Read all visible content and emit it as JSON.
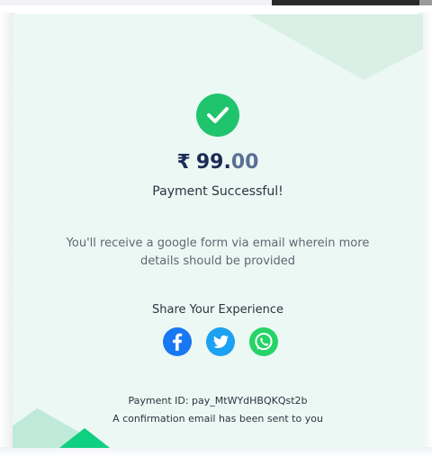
{
  "payment": {
    "currency_symbol": "₹",
    "amount_whole": "99.",
    "amount_decimal": "00",
    "status": "Payment Successful!",
    "message": "You'll receive a google form via email wherein more details should be provided",
    "share_title": "Share Your Experience",
    "payment_id": "Payment ID: pay_MtWYdHBQKQst2b",
    "confirmation": "A confirmation email has been sent to you"
  },
  "social_icons": [
    "facebook-icon",
    "twitter-icon",
    "whatsapp-icon"
  ],
  "colors": {
    "success": "#1fc46d",
    "card_bg": "#ecf8f3",
    "amount_text": "#1c2b55",
    "facebook": "#1877f2",
    "twitter": "#1da1f2",
    "whatsapp": "#25d366"
  }
}
